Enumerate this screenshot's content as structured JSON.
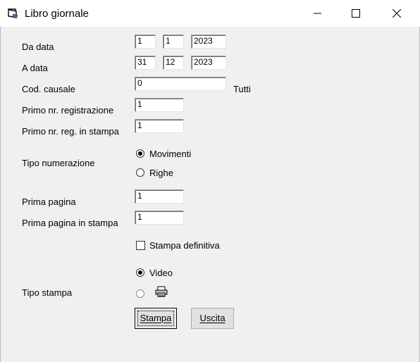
{
  "window": {
    "title": "Libro giornale"
  },
  "form": {
    "da_data": {
      "label": "Da data",
      "day": "1",
      "month": "1",
      "year": "2023"
    },
    "a_data": {
      "label": "A data",
      "day": "31",
      "month": "12",
      "year": "2023"
    },
    "cod_causale": {
      "label": "Cod. causale",
      "value": "0",
      "hint": "Tutti"
    },
    "primo_nr_reg": {
      "label": "Primo nr. registrazione",
      "value": "1"
    },
    "primo_nr_reg_stampa": {
      "label": "Primo nr. reg. in stampa",
      "value": "1"
    },
    "tipo_numerazione": {
      "label": "Tipo numerazione",
      "options": [
        "Movimenti",
        "Righe"
      ],
      "selected": "Movimenti"
    },
    "prima_pagina": {
      "label": "Prima pagina",
      "value": "1"
    },
    "prima_pagina_stampa": {
      "label": "Prima pagina in stampa",
      "value": "1"
    },
    "stampa_definitiva": {
      "label": "Stampa definitiva",
      "checked": false
    },
    "tipo_stampa": {
      "label": "Tipo stampa",
      "options": [
        "Video",
        "printer-icon"
      ],
      "selected": "Video"
    }
  },
  "buttons": {
    "stampa": "Stampa",
    "uscita": "Uscita"
  }
}
